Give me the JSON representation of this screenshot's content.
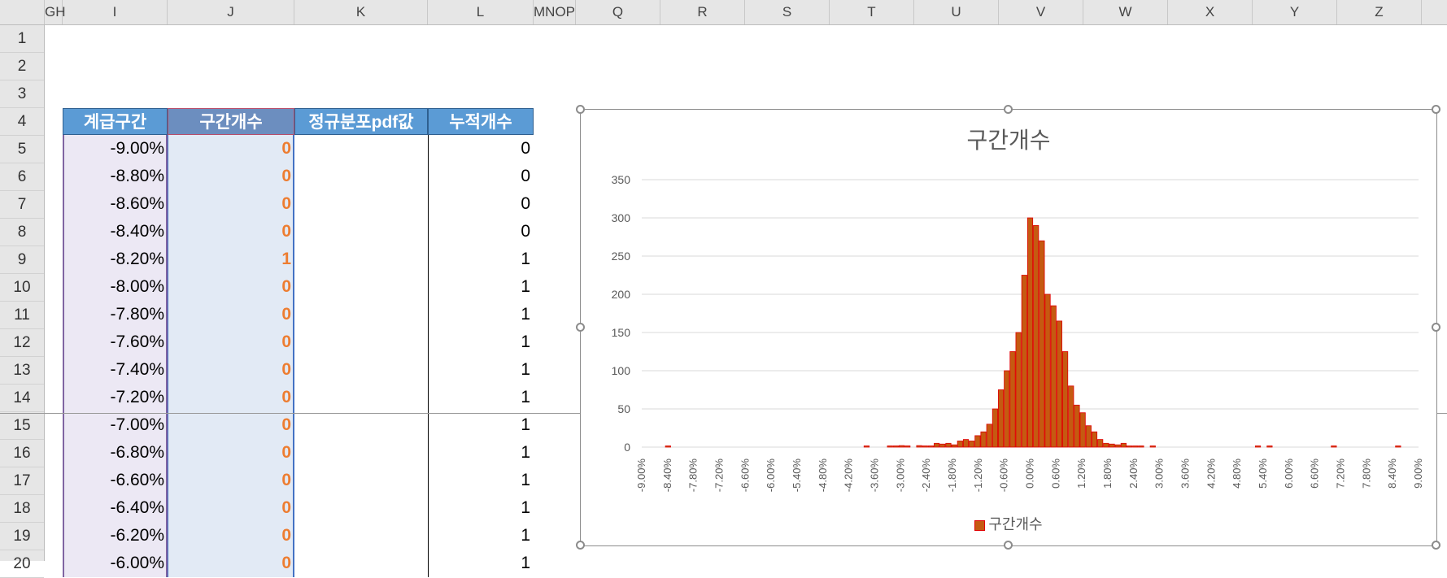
{
  "columns": [
    "GH",
    "I",
    "J",
    "K",
    "L",
    "MNOP",
    "Q",
    "R",
    "S",
    "T",
    "U",
    "V",
    "W",
    "X",
    "Y",
    "Z"
  ],
  "rows": [
    "1",
    "2",
    "3",
    "4",
    "5",
    "6",
    "7",
    "8",
    "9",
    "10",
    "11",
    "12",
    "13",
    "14",
    "15",
    "16",
    "17",
    "18",
    "19",
    "20"
  ],
  "table": {
    "headers": [
      "계급구간",
      "구간개수",
      "정규분포pdf값",
      "누적개수"
    ],
    "rows": [
      {
        "class": "-9.00%",
        "count": "0",
        "pdf": "",
        "cum": "0"
      },
      {
        "class": "-8.80%",
        "count": "0",
        "pdf": "",
        "cum": "0"
      },
      {
        "class": "-8.60%",
        "count": "0",
        "pdf": "",
        "cum": "0"
      },
      {
        "class": "-8.40%",
        "count": "0",
        "pdf": "",
        "cum": "0"
      },
      {
        "class": "-8.20%",
        "count": "1",
        "pdf": "",
        "cum": "1"
      },
      {
        "class": "-8.00%",
        "count": "0",
        "pdf": "",
        "cum": "1"
      },
      {
        "class": "-7.80%",
        "count": "0",
        "pdf": "",
        "cum": "1"
      },
      {
        "class": "-7.60%",
        "count": "0",
        "pdf": "",
        "cum": "1"
      },
      {
        "class": "-7.40%",
        "count": "0",
        "pdf": "",
        "cum": "1"
      },
      {
        "class": "-7.20%",
        "count": "0",
        "pdf": "",
        "cum": "1"
      },
      {
        "class": "-7.00%",
        "count": "0",
        "pdf": "",
        "cum": "1"
      },
      {
        "class": "-6.80%",
        "count": "0",
        "pdf": "",
        "cum": "1"
      },
      {
        "class": "-6.60%",
        "count": "0",
        "pdf": "",
        "cum": "1"
      },
      {
        "class": "-6.40%",
        "count": "0",
        "pdf": "",
        "cum": "1"
      },
      {
        "class": "-6.20%",
        "count": "0",
        "pdf": "",
        "cum": "1"
      },
      {
        "class": "-6.00%",
        "count": "0",
        "pdf": "",
        "cum": "1"
      }
    ]
  },
  "colors": {
    "header_bg": "#5b9bd5",
    "count_text": "#ed7d31",
    "bar_fill": "#c55a11",
    "bar_edge": "#e00000",
    "selection_blue": "#dce6f1",
    "selection_purple": "#e8e3f0"
  },
  "chart_data": {
    "type": "bar",
    "title": "구간개수",
    "legend": "구간개수",
    "legend_position": "bottom",
    "grid": true,
    "ylim": [
      0,
      350
    ],
    "yticks": [
      "0",
      "50",
      "100",
      "150",
      "200",
      "250",
      "300",
      "350"
    ],
    "xticks": [
      "-9.00%",
      "-8.40%",
      "-7.80%",
      "-7.20%",
      "-6.60%",
      "-6.00%",
      "-5.40%",
      "-4.80%",
      "-4.20%",
      "-3.60%",
      "-3.00%",
      "-2.40%",
      "-1.80%",
      "-1.20%",
      "-0.60%",
      "0.00%",
      "0.60%",
      "1.20%",
      "1.80%",
      "2.40%",
      "3.00%",
      "3.60%",
      "4.20%",
      "4.80%",
      "5.40%",
      "6.00%",
      "6.60%",
      "7.20%",
      "7.80%",
      "8.40%",
      "9.00%"
    ],
    "categories_start": -9.0,
    "categories_step": 0.2,
    "values": [
      0,
      0,
      0,
      0,
      1,
      0,
      0,
      0,
      0,
      0,
      0,
      0,
      0,
      0,
      0,
      0,
      0,
      0,
      0,
      0,
      0,
      0,
      0,
      0,
      0,
      0,
      0,
      0,
      0,
      0,
      0,
      0,
      0,
      0,
      0,
      0,
      0,
      0,
      1,
      0,
      0,
      0,
      1,
      1,
      2,
      1,
      0,
      2,
      1,
      1,
      5,
      4,
      5,
      3,
      8,
      10,
      8,
      15,
      20,
      30,
      50,
      75,
      100,
      125,
      150,
      225,
      300,
      290,
      270,
      200,
      185,
      165,
      125,
      80,
      55,
      45,
      28,
      20,
      10,
      5,
      4,
      3,
      5,
      1,
      1,
      1,
      0,
      1,
      0,
      0,
      0,
      0,
      0,
      0,
      0,
      0,
      0,
      0,
      0,
      0,
      0,
      0,
      0,
      0,
      0,
      1,
      0,
      1,
      0,
      0,
      0,
      0,
      0,
      0,
      0,
      0,
      0,
      0,
      1,
      0,
      0,
      0,
      0,
      0,
      0,
      0,
      0,
      0,
      0,
      1,
      0,
      0,
      0
    ]
  }
}
